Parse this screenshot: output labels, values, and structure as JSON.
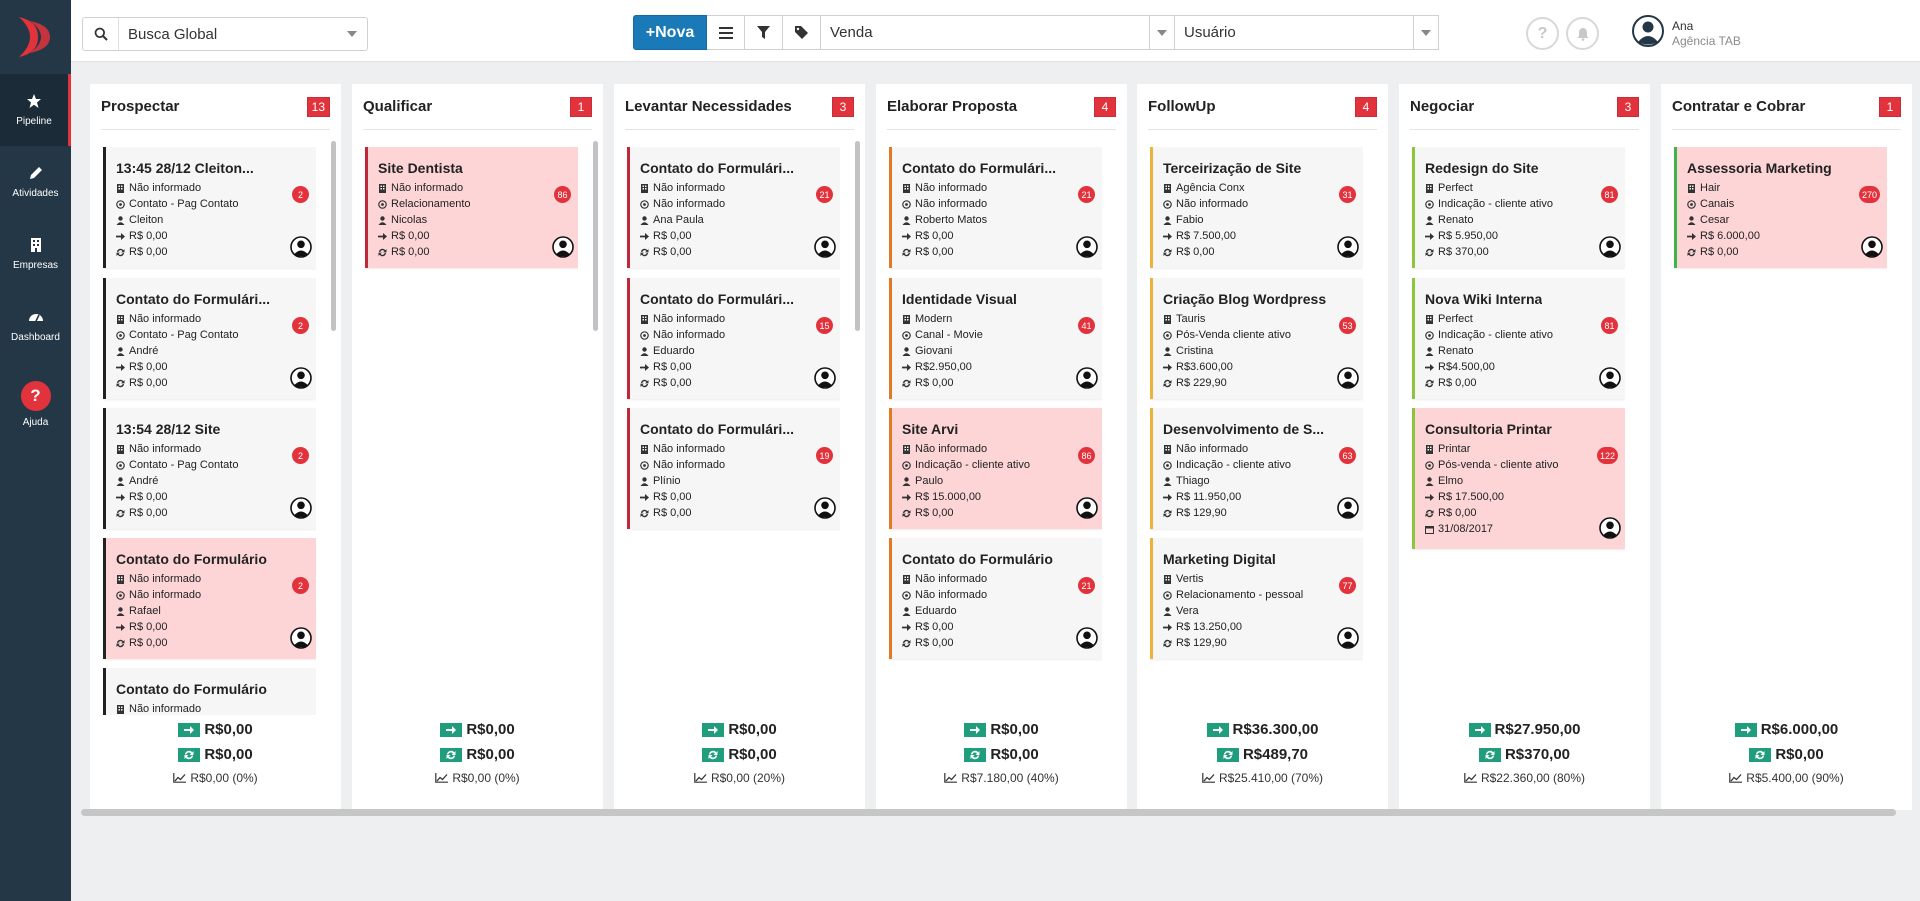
{
  "app": {
    "colors": {
      "sidebar": "#233746",
      "accent": "#e2333d",
      "primary_button": "#1a7ab7",
      "money_icon": "#1f9d7c"
    }
  },
  "sidebar": {
    "logo": "tab-logo-icon",
    "items": [
      {
        "label": "Pipeline",
        "icon": "star-icon",
        "active": true
      },
      {
        "label": "Atividades",
        "icon": "pencil-icon"
      },
      {
        "label": "Empresas",
        "icon": "building-icon"
      },
      {
        "label": "Dashboard",
        "icon": "gauge-icon"
      },
      {
        "label": "Ajuda",
        "icon": "help-icon",
        "glyph": "?"
      }
    ]
  },
  "topbar": {
    "search": {
      "value": "Busca Global"
    },
    "nova_label": "+Nova",
    "pipeline_select": "Venda",
    "user_select": "Usuário",
    "help_glyph": "?",
    "user": {
      "name": "Ana",
      "org": "Agência TAB"
    }
  },
  "columns": [
    {
      "title": "Prospectar",
      "count": "13",
      "totals": {
        "value": "R$0,00",
        "recurring": "R$0,00",
        "forecast": "R$0,00 (0%)"
      },
      "cards": [
        {
          "title": "13:45 28/12 Cleiton...",
          "badge": "2",
          "pink": false,
          "lines": [
            "Não informado",
            "Contato - Pag Contato",
            "Cleiton",
            "R$ 0,00",
            "R$ 0,00"
          ]
        },
        {
          "title": "Contato do Formulári...",
          "badge": "2",
          "pink": false,
          "lines": [
            "Não informado",
            "Contato - Pag Contato",
            "André",
            "R$ 0,00",
            "R$ 0,00"
          ]
        },
        {
          "title": "13:54 28/12 Site",
          "badge": "2",
          "pink": false,
          "lines": [
            "Não informado",
            "Contato - Pag Contato",
            "André",
            "R$ 0,00",
            "R$ 0,00"
          ]
        },
        {
          "title": "Contato do Formulário",
          "badge": "2",
          "pink": true,
          "lines": [
            "Não informado",
            "Não informado",
            "Rafael",
            "R$ 0,00",
            "R$ 0,00"
          ]
        },
        {
          "title": "Contato do Formulário",
          "badge": "",
          "pink": false,
          "lines": [
            "Não informado",
            "",
            "",
            "",
            ""
          ]
        }
      ]
    },
    {
      "title": "Qualificar",
      "count": "1",
      "totals": {
        "value": "R$0,00",
        "recurring": "R$0,00",
        "forecast": "R$0,00 (0%)"
      },
      "cards": [
        {
          "title": "Site Dentista",
          "badge": "86",
          "pink": true,
          "lines": [
            "Não informado",
            "Relacionamento",
            "Nicolas",
            "R$ 0,00",
            "R$ 0,00"
          ]
        }
      ]
    },
    {
      "title": "Levantar Necessidades",
      "count": "3",
      "totals": {
        "value": "R$0,00",
        "recurring": "R$0,00",
        "forecast": "R$0,00 (20%)"
      },
      "cards": [
        {
          "title": "Contato do Formulári...",
          "badge": "21",
          "pink": false,
          "lines": [
            "Não informado",
            "Não informado",
            "Ana Paula",
            "R$ 0,00",
            "R$ 0,00"
          ]
        },
        {
          "title": "Contato do Formulári...",
          "badge": "15",
          "pink": false,
          "lines": [
            "Não informado",
            "Não informado",
            "Eduardo",
            "R$ 0,00",
            "R$ 0,00"
          ]
        },
        {
          "title": "Contato do Formulári...",
          "badge": "19",
          "pink": false,
          "lines": [
            "Não informado",
            "Não informado",
            "Plínio",
            "R$ 0,00",
            "R$ 0,00"
          ]
        }
      ]
    },
    {
      "title": "Elaborar Proposta",
      "count": "4",
      "totals": {
        "value": "R$0,00",
        "recurring": "R$0,00",
        "forecast": "R$7.180,00 (40%)"
      },
      "cards": [
        {
          "title": "Contato do Formulári...",
          "badge": "21",
          "pink": false,
          "lines": [
            "Não informado",
            "Não informado",
            "Roberto Matos",
            "R$ 0,00",
            "R$ 0,00"
          ]
        },
        {
          "title": "Identidade Visual",
          "badge": "41",
          "pink": false,
          "lines": [
            "Modern",
            "Canal - Movie",
            "Giovani",
            "R$2.950,00",
            "R$ 0,00"
          ]
        },
        {
          "title": "Site Arvi",
          "badge": "86",
          "pink": true,
          "lines": [
            "Não informado",
            "Indicação - cliente ativo",
            "Paulo",
            "R$ 15.000,00",
            "R$ 0,00"
          ]
        },
        {
          "title": "Contato do Formulário",
          "badge": "21",
          "pink": false,
          "lines": [
            "Não informado",
            "Não informado",
            "Eduardo",
            "R$ 0,00",
            "R$ 0,00"
          ]
        }
      ]
    },
    {
      "title": "FollowUp",
      "count": "4",
      "totals": {
        "value": "R$36.300,00",
        "recurring": "R$489,70",
        "forecast": "R$25.410,00 (70%)"
      },
      "cards": [
        {
          "title": "Terceirização de Site",
          "badge": "31",
          "pink": false,
          "lines": [
            "Agência Conx",
            "Não informado",
            "Fabio",
            "R$ 7.500,00",
            "R$ 0,00"
          ]
        },
        {
          "title": "Criação Blog Wordpress",
          "badge": "53",
          "pink": false,
          "lines": [
            "Tauris",
            "Pós-Venda cliente ativo",
            "Cristina",
            "R$3.600,00",
            "R$ 229,90"
          ]
        },
        {
          "title": "Desenvolvimento de S...",
          "badge": "63",
          "pink": false,
          "lines": [
            "Não informado",
            "Indicação - cliente ativo",
            "Thiago",
            "R$ 11.950,00",
            "R$ 129,90"
          ]
        },
        {
          "title": "Marketing Digital",
          "badge": "77",
          "pink": false,
          "lines": [
            "Vertis",
            "Relacionamento - pessoal",
            "Vera",
            "R$ 13.250,00",
            "R$ 129,90"
          ]
        }
      ]
    },
    {
      "title": "Negociar",
      "count": "3",
      "totals": {
        "value": "R$27.950,00",
        "recurring": "R$370,00",
        "forecast": "R$22.360,00 (80%)"
      },
      "cards": [
        {
          "title": "Redesign do Site",
          "badge": "81",
          "pink": false,
          "lines": [
            "Perfect",
            "Indicação - cliente ativo",
            "Renato",
            "R$ 5.950,00",
            "R$ 370,00"
          ]
        },
        {
          "title": "Nova Wiki Interna",
          "badge": "81",
          "pink": false,
          "lines": [
            "Perfect",
            "Indicação - cliente ativo",
            "Renato",
            "R$4.500,00",
            "R$ 0,00"
          ]
        },
        {
          "title": "Consultoria Printar",
          "badge": "122",
          "pink": true,
          "lines": [
            "Printar",
            "Pós-venda - cliente ativo",
            "Elmo",
            "R$ 17.500,00",
            "R$ 0,00",
            "31/08/2017"
          ]
        }
      ]
    },
    {
      "title": "Contratar e Cobrar",
      "count": "1",
      "totals": {
        "value": "R$6.000,00",
        "recurring": "R$0,00",
        "forecast": "R$5.400,00 (90%)"
      },
      "cards": [
        {
          "title": "Assessoria Marketing",
          "badge": "270",
          "pink": true,
          "lines": [
            "Hair",
            "Canais",
            "Cesar",
            "R$ 6.000,00",
            "R$ 0,00"
          ]
        }
      ]
    }
  ]
}
